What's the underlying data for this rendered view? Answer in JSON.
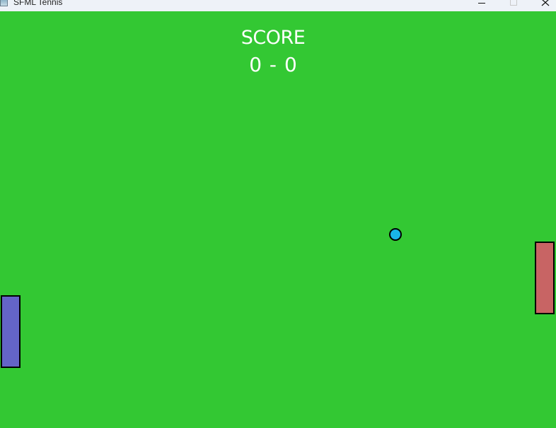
{
  "window": {
    "title": "SFML Tennis",
    "icon": "app-window-icon",
    "controls": [
      "minimize-icon",
      "maximize-icon",
      "close-icon"
    ]
  },
  "scoreboard": {
    "label": "SCORE",
    "value": "0 - 0",
    "left_score": 0,
    "right_score": 0
  },
  "colors": {
    "court": "#33c833",
    "left_paddle": "#6464c8",
    "right_paddle": "#c86464",
    "ball": "#19b4e6",
    "outline": "#000000",
    "score_text": "#ffffff"
  }
}
